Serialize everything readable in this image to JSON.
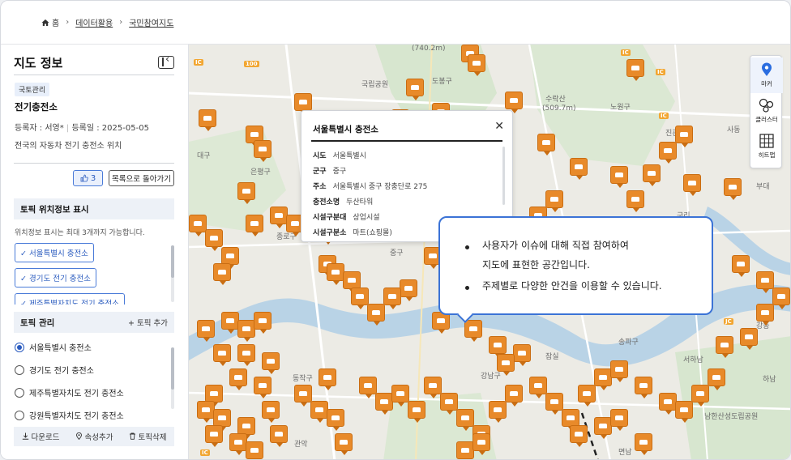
{
  "breadcrumb": {
    "home": "홈",
    "items": [
      "데이터활용",
      "국민참여지도"
    ]
  },
  "sidebar": {
    "title": "지도 정보",
    "category": "국토관리",
    "topic_title": "전기충전소",
    "author_label": "등록자 : 서영*",
    "date_label": "등록일 : 2025-05-05",
    "description": "전국의 자동차 전기 충전소 위치",
    "like_count": "3",
    "back_label": "목록으로 돌아가기",
    "location_section": {
      "title": "토픽 위치정보 표시",
      "note": "위치정보 표시는 최대 3개까지 가능합니다.",
      "chips": [
        "✓ 서울특별시 충전소",
        "✓ 경기도 전기 충전소",
        "✓ 제주특별자치도 전기 충전소"
      ]
    },
    "topic_manage": {
      "title": "토픽 관리",
      "add_label": "+ 토픽 추가",
      "items": [
        "서울특별시 충전소",
        "경기도 전기 충전소",
        "제주특별자치도 전기 충전소",
        "강원특별자치도 전기 충전소"
      ],
      "selected_index": 0
    },
    "footer": {
      "download": "다운로드",
      "add_attr": "속성추가",
      "delete": "토픽삭제"
    }
  },
  "popup": {
    "title": "서울특별시 충전소",
    "rows": [
      {
        "k": "시도",
        "v": "서울특별시"
      },
      {
        "k": "군구",
        "v": "중구"
      },
      {
        "k": "주소",
        "v": "서울특별시 중구 장충단로 275"
      },
      {
        "k": "충전소명",
        "v": "두산타워"
      },
      {
        "k": "시설구분대",
        "v": "상업시설"
      },
      {
        "k": "시설구분소",
        "v": "마트(쇼핑몰)"
      }
    ]
  },
  "callout": {
    "line1a": "사용자가 이슈에 대해 직접 참여하여",
    "line1b": "지도에 표현한 공간입니다.",
    "line2": "주제별로 다양한 안건을 이용할 수 있습니다."
  },
  "toolbar": {
    "marker": "마커",
    "cluster": "클러스터",
    "heatmap": "히트맵"
  },
  "map_labels": [
    "(740.2m)",
    "도봉구",
    "국립공원",
    "(509.7m)",
    "수락산",
    "노원구",
    "진관",
    "사동",
    "부대",
    "은평구",
    "대구",
    "종로구",
    "중구",
    "동작구",
    "강남구",
    "송파구",
    "관악",
    "서하남",
    "남한산성도립공원",
    "하남",
    "구리",
    "강동",
    "잠실",
    "면남"
  ],
  "colors": {
    "accent": "#3b73d6",
    "pin": "#e88a2a",
    "panel": "#edf1f7"
  }
}
